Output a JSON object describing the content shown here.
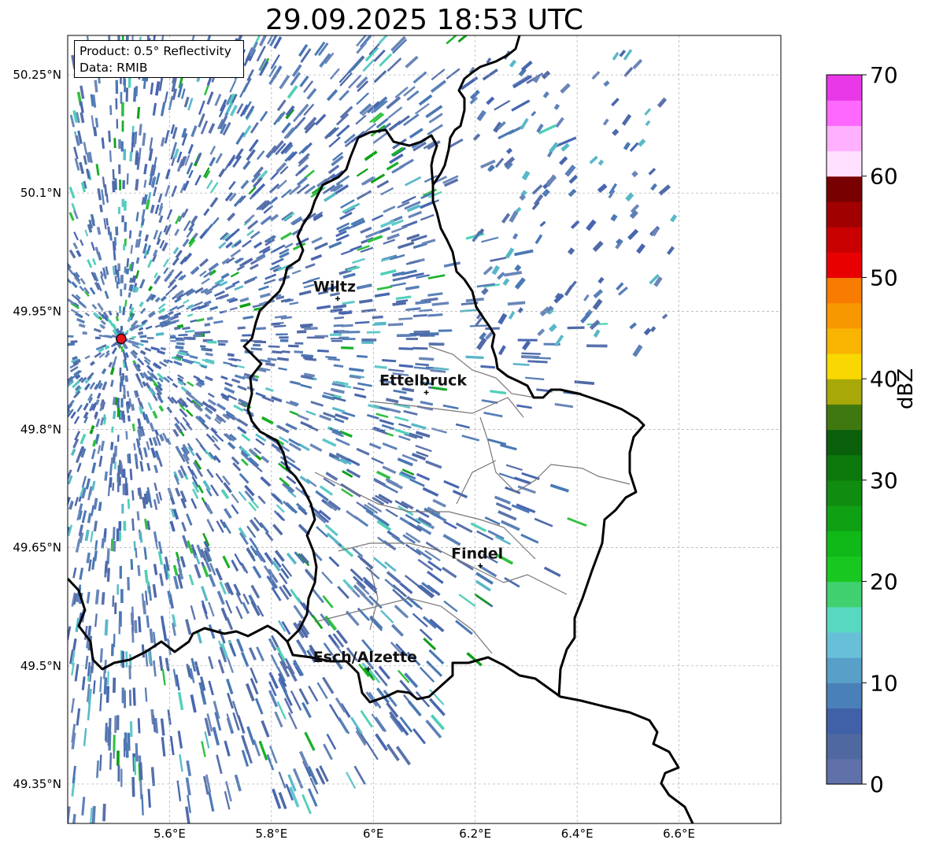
{
  "title": "29.09.2025 18:53 UTC",
  "info_box": {
    "product": "Product: 0.5° Reflectivity",
    "data": "Data: RMIB"
  },
  "map": {
    "extent": {
      "lon_min": 5.4,
      "lon_max": 6.8,
      "lat_min": 49.3,
      "lat_max": 50.3
    },
    "lon_ticks": [
      {
        "value": 5.6,
        "label": "5.6°E"
      },
      {
        "value": 5.8,
        "label": "5.8°E"
      },
      {
        "value": 6.0,
        "label": "6°E"
      },
      {
        "value": 6.2,
        "label": "6.2°E"
      },
      {
        "value": 6.4,
        "label": "6.4°E"
      },
      {
        "value": 6.6,
        "label": "6.6°E"
      }
    ],
    "lat_ticks": [
      {
        "value": 50.25,
        "label": "50.25°N"
      },
      {
        "value": 50.1,
        "label": "50.1°N"
      },
      {
        "value": 49.95,
        "label": "49.95°N"
      },
      {
        "value": 49.8,
        "label": "49.8°N"
      },
      {
        "value": 49.65,
        "label": "49.65°N"
      },
      {
        "value": 49.5,
        "label": "49.5°N"
      },
      {
        "value": 49.35,
        "label": "49.35°N"
      }
    ],
    "radar_site": {
      "lon": 5.505,
      "lat": 49.915,
      "color": "#e8141e"
    },
    "cities": [
      {
        "name": "Wiltz",
        "lon": 5.93,
        "lat": 49.966
      },
      {
        "name": "Ettelbruck",
        "lon": 6.104,
        "lat": 49.847
      },
      {
        "name": "Findel",
        "lon": 6.21,
        "lat": 49.627
      },
      {
        "name": "Esch/Alzette",
        "lon": 5.99,
        "lat": 49.496
      }
    ]
  },
  "colorbar": {
    "label": "dBZ",
    "min": 0,
    "max": 70,
    "step": 2.5,
    "ticks": [
      {
        "value": 0,
        "label": "0"
      },
      {
        "value": 10,
        "label": "10"
      },
      {
        "value": 20,
        "label": "20"
      },
      {
        "value": 30,
        "label": "30"
      },
      {
        "value": 40,
        "label": "40"
      },
      {
        "value": 50,
        "label": "50"
      },
      {
        "value": 60,
        "label": "60"
      },
      {
        "value": 70,
        "label": "70"
      }
    ],
    "colors": [
      "#6070a8",
      "#5068a0",
      "#4060a8",
      "#4a80b8",
      "#58a0c8",
      "#68c0d8",
      "#58d8c0",
      "#40d070",
      "#18c820",
      "#10b818",
      "#10a014",
      "#108c10",
      "#0c780c",
      "#0a600a",
      "#407810",
      "#a8a808",
      "#f8d800",
      "#f8b400",
      "#f89800",
      "#f87c00",
      "#e80000",
      "#c80000",
      "#a00000",
      "#780000",
      "#ffe0ff",
      "#ffb0ff",
      "#ff68ff",
      "#e838e8"
    ]
  }
}
